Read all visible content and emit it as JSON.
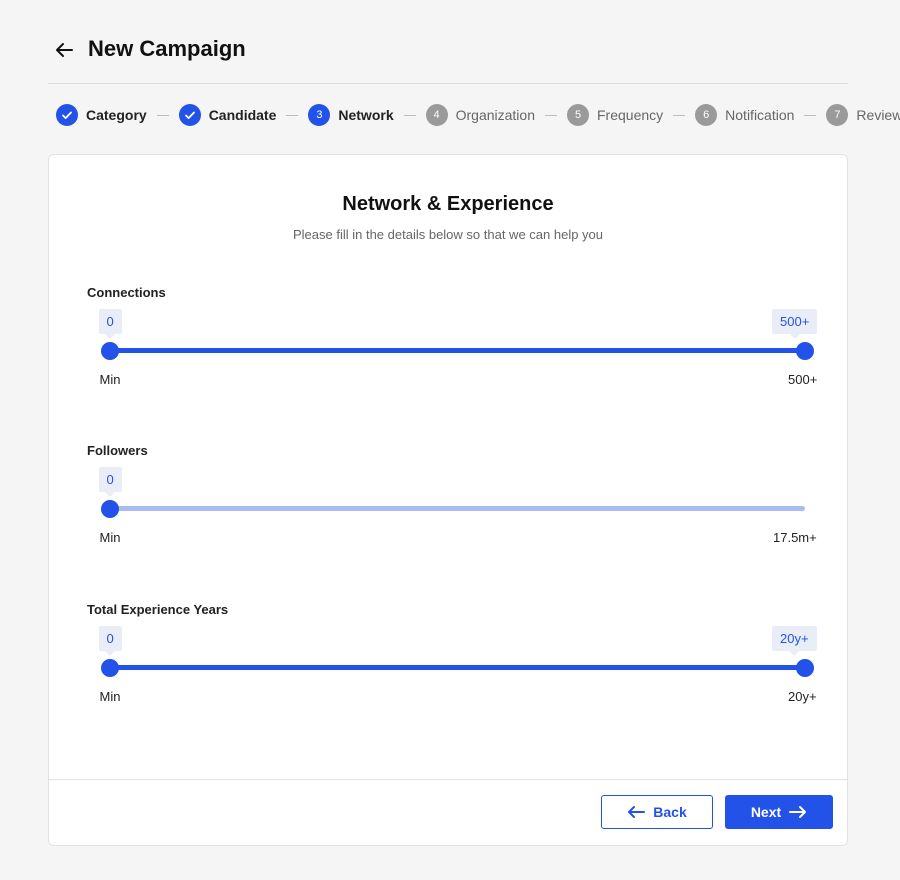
{
  "header": {
    "title": "New Campaign"
  },
  "stepper": {
    "steps": [
      {
        "number": "1",
        "label": "Category",
        "state": "done"
      },
      {
        "number": "2",
        "label": "Candidate",
        "state": "done"
      },
      {
        "number": "3",
        "label": "Network",
        "state": "active"
      },
      {
        "number": "4",
        "label": "Organization",
        "state": "pending"
      },
      {
        "number": "5",
        "label": "Frequency",
        "state": "pending"
      },
      {
        "number": "6",
        "label": "Notification",
        "state": "pending"
      },
      {
        "number": "7",
        "label": "Review",
        "state": "pending"
      }
    ]
  },
  "card": {
    "title": "Network & Experience",
    "subtitle": "Please fill in the details below so that we can help you"
  },
  "sliders": [
    {
      "label": "Connections",
      "min_value": "0",
      "max_value": "500+",
      "min_label": "Min",
      "max_label": "500+",
      "range_fraction": [
        0,
        1
      ],
      "show_max_tag": true
    },
    {
      "label": "Followers",
      "min_value": "0",
      "max_value": "",
      "min_label": "Min",
      "max_label": "17.5m+",
      "range_fraction": [
        0,
        0
      ],
      "show_max_tag": false
    },
    {
      "label": "Total Experience Years",
      "min_value": "0",
      "max_value": "20y+",
      "min_label": "Min",
      "max_label": "20y+",
      "range_fraction": [
        0,
        1
      ],
      "show_max_tag": true
    }
  ],
  "footer": {
    "back_label": "Back",
    "next_label": "Next"
  },
  "colors": {
    "accent": "#2352e8",
    "track_light": "#a9bdf2",
    "tag_bg": "#e8edf8",
    "pending": "#9a9a9a"
  }
}
